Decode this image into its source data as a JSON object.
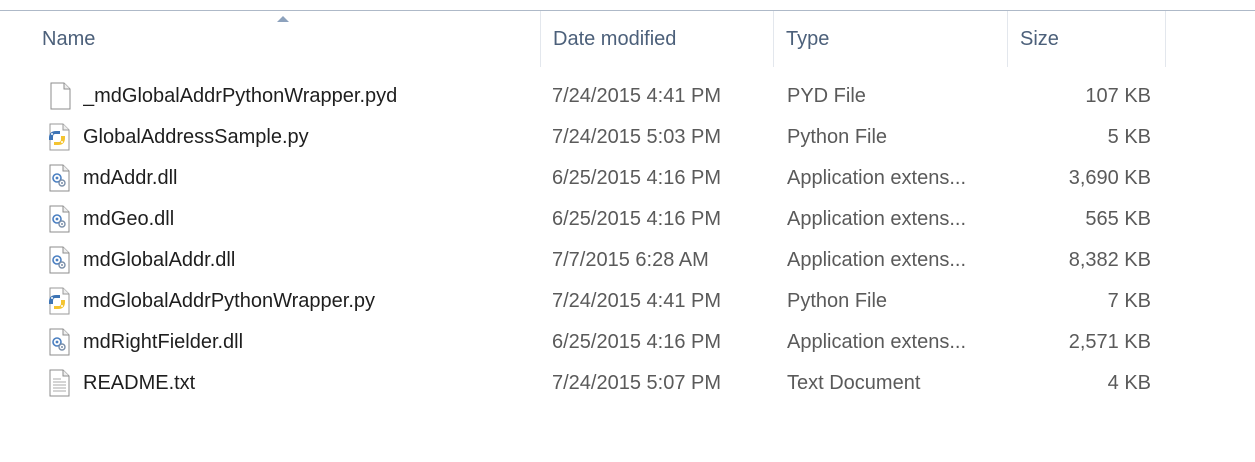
{
  "columns": {
    "name": "Name",
    "date": "Date modified",
    "type": "Type",
    "size": "Size"
  },
  "files": [
    {
      "icon": "blank-file-icon",
      "name": "_mdGlobalAddrPythonWrapper.pyd",
      "date": "7/24/2015 4:41 PM",
      "type": "PYD File",
      "size": "107 KB"
    },
    {
      "icon": "python-file-icon",
      "name": "GlobalAddressSample.py",
      "date": "7/24/2015 5:03 PM",
      "type": "Python File",
      "size": "5 KB"
    },
    {
      "icon": "dll-file-icon",
      "name": "mdAddr.dll",
      "date": "6/25/2015 4:16 PM",
      "type": "Application extens...",
      "size": "3,690 KB"
    },
    {
      "icon": "dll-file-icon",
      "name": "mdGeo.dll",
      "date": "6/25/2015 4:16 PM",
      "type": "Application extens...",
      "size": "565 KB"
    },
    {
      "icon": "dll-file-icon",
      "name": "mdGlobalAddr.dll",
      "date": "7/7/2015 6:28 AM",
      "type": "Application extens...",
      "size": "8,382 KB"
    },
    {
      "icon": "python-file-icon",
      "name": "mdGlobalAddrPythonWrapper.py",
      "date": "7/24/2015 4:41 PM",
      "type": "Python File",
      "size": "7 KB"
    },
    {
      "icon": "dll-file-icon",
      "name": "mdRightFielder.dll",
      "date": "6/25/2015 4:16 PM",
      "type": "Application extens...",
      "size": "2,571 KB"
    },
    {
      "icon": "text-file-icon",
      "name": "README.txt",
      "date": "7/24/2015 5:07 PM",
      "type": "Text Document",
      "size": "4 KB"
    }
  ]
}
